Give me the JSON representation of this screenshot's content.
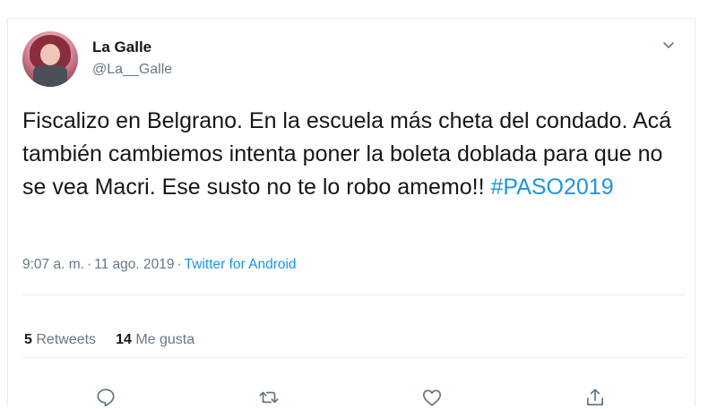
{
  "tweet": {
    "author_name": "La Galle",
    "author_handle": "@La__Galle",
    "text": "Fiscalizo en Belgrano. En la escuela más cheta del condado. Acá también cambiemos intenta poner la boleta doblada para que no se vea Macri. Ese susto no te lo robo amemo!! ",
    "hashtag": "#PASO2019",
    "time": "9:07 a. m.",
    "date": "11 ago. 2019",
    "separator": "·",
    "source": "Twitter for Android"
  },
  "stats": {
    "retweets_count": "5",
    "retweets_label": "Retweets",
    "likes_count": "14",
    "likes_label": "Me gusta"
  },
  "icons": {
    "avatar": "avatar",
    "menu": "chevron-down-icon",
    "reply": "reply-icon",
    "retweet": "retweet-icon",
    "like": "heart-icon",
    "share": "share-icon"
  },
  "colors": {
    "link": "#1b95e0",
    "secondary_text": "#657786",
    "primary_text": "#14171a",
    "border": "#e6ecf0"
  }
}
